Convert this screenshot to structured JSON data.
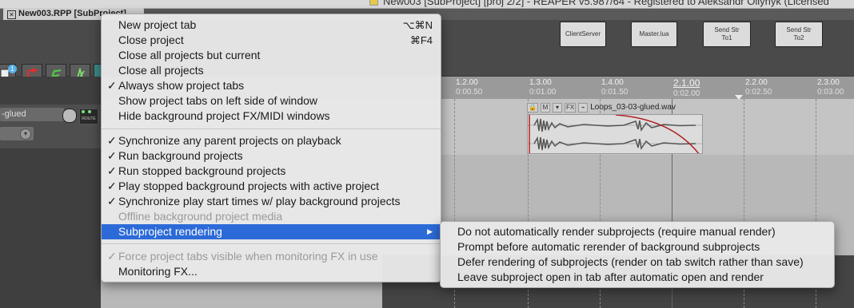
{
  "window": {
    "title": "New003 [SubProject] [proj 2/2] - REAPER v5.987/64 - Registered to Aleksandr Oliynyk (Licensed"
  },
  "tab": {
    "label": "New003.RPP [SubProject]"
  },
  "toolbar_buttons": [
    {
      "label": "ClientServer"
    },
    {
      "label": "Master.lua"
    },
    {
      "label": "Send Str To1"
    },
    {
      "label": "Send Str To2"
    }
  ],
  "left_icons": {
    "badge": "1"
  },
  "track": {
    "name": "-glued",
    "route_label": "ROUTE"
  },
  "ruler": {
    "ticks": [
      {
        "bar": "1.2.00",
        "time": "0:00.50"
      },
      {
        "bar": "1.3.00",
        "time": "0:01.00"
      },
      {
        "bar": "1.4.00",
        "time": "0:01.50"
      },
      {
        "bar": "2.1.00",
        "time": "0:02.00"
      },
      {
        "bar": "2.2.00",
        "time": "0:02.50"
      },
      {
        "bar": "2.3.00",
        "time": "0:03.00"
      }
    ]
  },
  "item": {
    "name": "Loops_03-03-glued.wav",
    "header_icons": [
      "lock-icon",
      "M",
      "comment-icon",
      "FX",
      "envelope-icon"
    ]
  },
  "menu": {
    "items": [
      {
        "check": "",
        "label": "New project tab",
        "shortcut": "⌥⌘N",
        "disabled": false
      },
      {
        "check": "",
        "label": "Close project",
        "shortcut": "⌘F4",
        "disabled": false
      },
      {
        "check": "",
        "label": "Close all projects but current",
        "shortcut": "",
        "disabled": false
      },
      {
        "check": "",
        "label": "Close all projects",
        "shortcut": "",
        "disabled": false
      },
      {
        "check": "✓",
        "label": "Always show project tabs",
        "shortcut": "",
        "disabled": false
      },
      {
        "check": "",
        "label": "Show project tabs on left side of window",
        "shortcut": "",
        "disabled": false
      },
      {
        "check": "",
        "label": "Hide background project FX/MIDI windows",
        "shortcut": "",
        "disabled": false
      },
      {
        "check": "✓",
        "label": "Synchronize any parent projects on playback",
        "shortcut": "",
        "disabled": false
      },
      {
        "check": "✓",
        "label": "Run background projects",
        "shortcut": "",
        "disabled": false
      },
      {
        "check": "✓",
        "label": "Run stopped background projects",
        "shortcut": "",
        "disabled": false
      },
      {
        "check": "✓",
        "label": "Play stopped background projects with active project",
        "shortcut": "",
        "disabled": false
      },
      {
        "check": "✓",
        "label": "Synchronize play start times w/ play background projects",
        "shortcut": "",
        "disabled": false
      },
      {
        "check": "",
        "label": "Offline background project media",
        "shortcut": "",
        "disabled": true
      },
      {
        "check": "",
        "label": "Subproject rendering",
        "shortcut": "▶",
        "disabled": false,
        "highlighted": true
      },
      {
        "check": "✓",
        "label": "Force project tabs visible when monitoring FX in use",
        "shortcut": "",
        "disabled": true
      },
      {
        "check": "",
        "label": "Monitoring FX...",
        "shortcut": "",
        "disabled": false
      }
    ]
  },
  "submenu": {
    "items": [
      {
        "label": "Do not automatically render subprojects (require manual render)"
      },
      {
        "label": "Prompt before automatic rerender of background subprojects"
      },
      {
        "label": "Defer rendering of subprojects (render on tab switch rather than save)"
      },
      {
        "label": "Leave subproject open in tab after automatic open and render"
      }
    ]
  },
  "colors": {
    "highlight": "#2c6ad8",
    "menu_bg": "#e8e8e8",
    "arrange_bg": "#b8b8b8",
    "fade_curve": "#b02020"
  }
}
